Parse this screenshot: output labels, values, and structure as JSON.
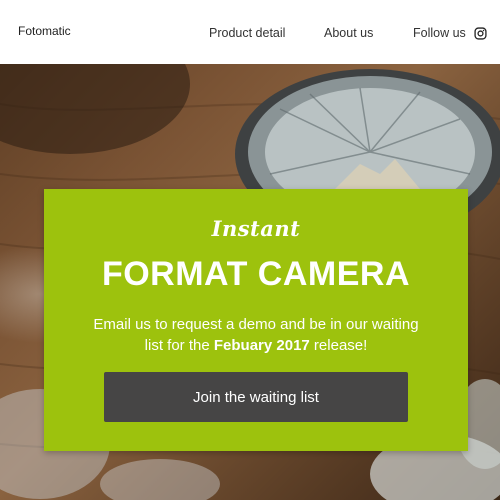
{
  "header": {
    "brand": "Fotomatic",
    "nav": {
      "product": "Product detail",
      "about": "About us",
      "follow": "Follow us"
    },
    "social_icon": "instagram-icon"
  },
  "hero": {
    "script_title": "Instant",
    "title": "FORMAT CAMERA",
    "description": {
      "before": "Email us to request a demo and be in our waiting list for the ",
      "bold": "Febuary 2017",
      "after": " release!"
    },
    "cta_label": "Join the waiting list"
  },
  "colors": {
    "card_green": "#9dc20d",
    "button_dark": "#464545",
    "text_white": "#ffffff"
  }
}
